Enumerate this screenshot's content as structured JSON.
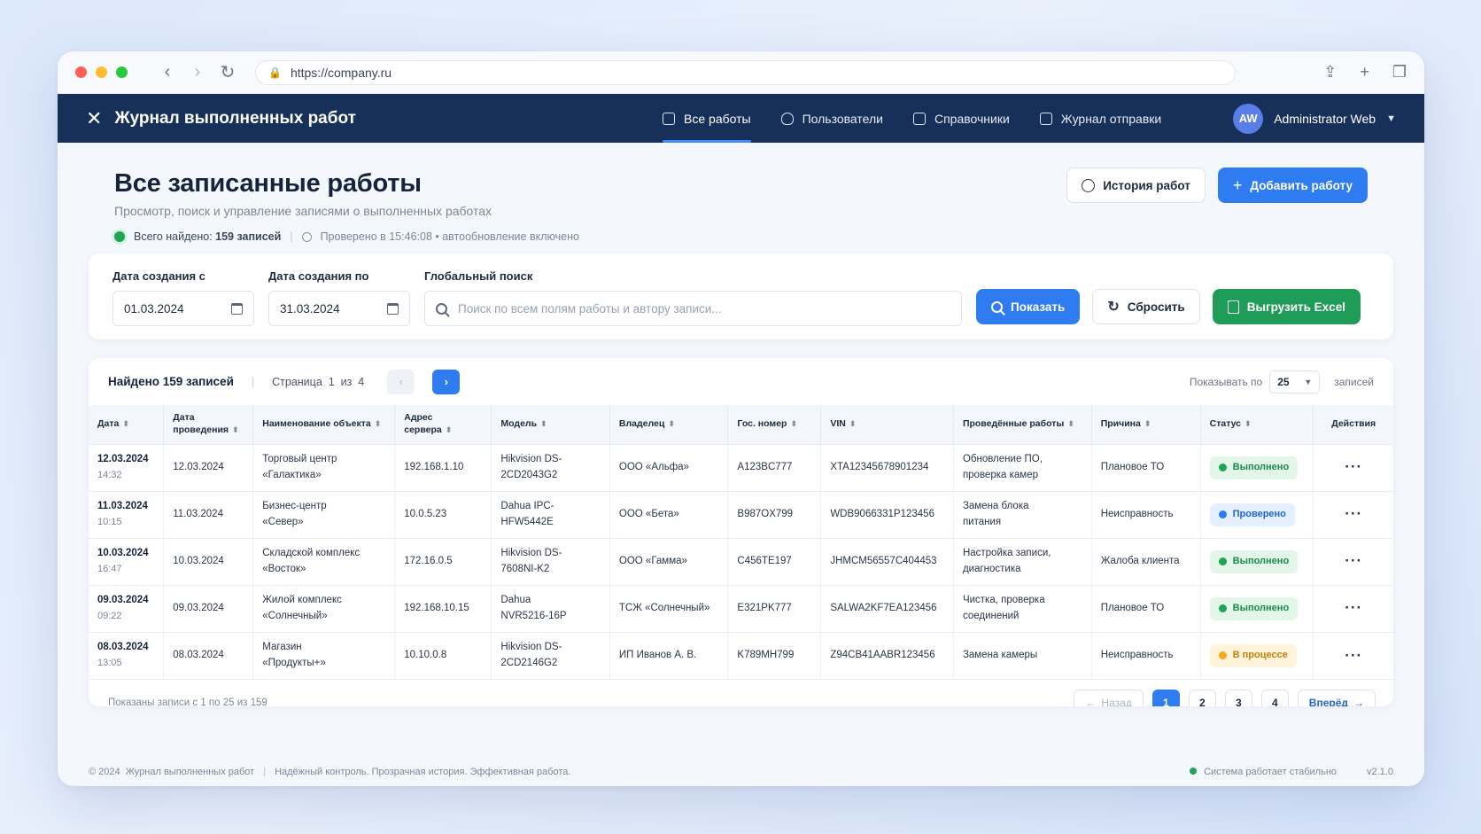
{
  "browser": {
    "url": "https://company.ru"
  },
  "app": {
    "title": "Журнал выполненных работ",
    "nav": [
      {
        "label": "Все работы",
        "active": true
      },
      {
        "label": "Пользователи",
        "active": false
      },
      {
        "label": "Справочники",
        "active": false
      },
      {
        "label": "Журнал отправки",
        "active": false
      }
    ],
    "user": {
      "initials": "AW",
      "name": "Administrator Web"
    }
  },
  "page": {
    "title": "Все записанные работы",
    "subtitle": "Просмотр, поиск и управление записями о выполненных работах",
    "total_label": "Всего найдено:",
    "total_value": "159 записей",
    "checked": "Проверено в 15:46:08 • автообновление включено",
    "history_btn": "История работ",
    "add_btn": "Добавить работу"
  },
  "filters": {
    "date_from_label": "Дата создания с",
    "date_from_value": "01.03.2024",
    "date_to_label": "Дата создания по",
    "date_to_value": "31.03.2024",
    "search_label": "Глобальный поиск",
    "search_placeholder": "Поиск по всем полям работы и автору записи...",
    "show_btn": "Показать",
    "reset_btn": "Сбросить",
    "export_btn": "Выгрузить Excel"
  },
  "table": {
    "found": "Найдено 159 записей",
    "page_info": "Страница  1  из  4",
    "per_page_label": "Показывать по",
    "per_page_value": "25",
    "per_page_suffix": "записей",
    "columns": [
      "Дата",
      "Дата проведения",
      "Наименование объекта",
      "Адрес сервера",
      "Модель",
      "Владелец",
      "Гос. номер",
      "VIN",
      "Проведённые работы",
      "Причина",
      "Статус",
      "Действия"
    ],
    "rows": [
      {
        "date": "12.03.2024",
        "time": "14:32",
        "held": "12.03.2024",
        "object": "Торговый центр «Галактика»",
        "server": "192.168.1.10",
        "model": "Hikvision DS-2CD2043G2",
        "owner": "ООО «Альфа»",
        "plate": "A123BC777",
        "vin": "XTA12345678901234",
        "works": "Обновление ПО, проверка камер",
        "reason": "Плановое ТО",
        "status": "Выполнено",
        "status_kind": "done"
      },
      {
        "date": "11.03.2024",
        "time": "10:15",
        "held": "11.03.2024",
        "object": "Бизнес-центр «Север»",
        "server": "10.0.5.23",
        "model": "Dahua IPC-HFW5442E",
        "owner": "ООО «Бета»",
        "plate": "B987OX799",
        "vin": "WDB9066331P123456",
        "works": "Замена блока питания",
        "reason": "Неисправность",
        "status": "Проверено",
        "status_kind": "check"
      },
      {
        "date": "10.03.2024",
        "time": "16:47",
        "held": "10.03.2024",
        "object": "Складской комплекс «Восток»",
        "server": "172.16.0.5",
        "model": "Hikvision DS-7608NI-K2",
        "owner": "ООО «Гамма»",
        "plate": "C456TE197",
        "vin": "JHMCM56557C404453",
        "works": "Настройка записи, диагностика",
        "reason": "Жалоба клиента",
        "status": "Выполнено",
        "status_kind": "done"
      },
      {
        "date": "09.03.2024",
        "time": "09:22",
        "held": "09.03.2024",
        "object": "Жилой комплекс «Солнечный»",
        "server": "192.168.10.15",
        "model": "Dahua NVR5216-16P",
        "owner": "ТСЖ «Солнечный»",
        "plate": "E321PK777",
        "vin": "SALWA2KF7EA123456",
        "works": "Чистка, проверка соединений",
        "reason": "Плановое ТО",
        "status": "Выполнено",
        "status_kind": "done"
      },
      {
        "date": "08.03.2024",
        "time": "13:05",
        "held": "08.03.2024",
        "object": "Магазин «Продукты+»",
        "server": "10.10.0.8",
        "model": "Hikvision DS-2CD2146G2",
        "owner": "ИП Иванов А. В.",
        "plate": "K789MH799",
        "vin": "Z94CB41AABR123456",
        "works": "Замена камеры",
        "reason": "Неисправность",
        "status": "В процессе",
        "status_kind": "prog"
      }
    ],
    "footer_info": "Показаны записи с 1 по 25 из 159",
    "back": "Назад",
    "pages": [
      "1",
      "2",
      "3",
      "4"
    ],
    "forward": "Вперёд"
  },
  "footer": {
    "copyright": "© 2024  Журнал выполненных работ",
    "slogan": "Надёжный контроль. Прозрачная история. Эффективная работа.",
    "system": "Система работает стабильно",
    "version": "v2.1.0"
  },
  "colors": {
    "appbar": "#16305a",
    "accent": "#2f7cf0",
    "success": "#1f9d58",
    "warning": "#f2a91d"
  }
}
